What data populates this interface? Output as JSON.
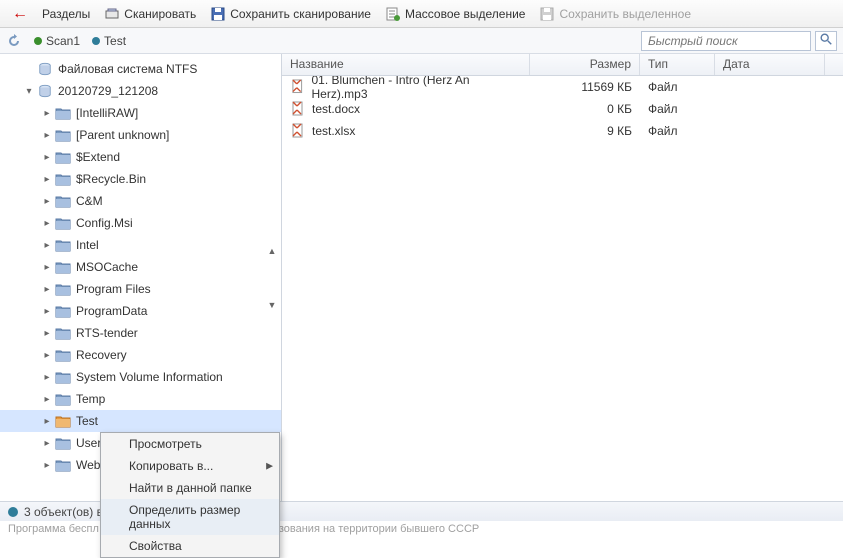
{
  "toolbar": {
    "back_label": "",
    "sections_label": "Разделы",
    "scan_label": "Сканировать",
    "save_scan_label": "Сохранить сканирование",
    "mass_select_label": "Массовое выделение",
    "save_selected_label": "Сохранить выделенное"
  },
  "tabs": {
    "scan1": "Scan1",
    "test": "Test"
  },
  "search": {
    "placeholder": "Быстрый поиск"
  },
  "tree": {
    "root_label": "Файловая система NTFS",
    "snapshot_label": "20120729_121208",
    "items": [
      "[IntelliRAW]",
      "[Parent unknown]",
      "$Extend",
      "$Recycle.Bin",
      "C&M",
      "Config.Msi",
      "Intel",
      "MSOCache",
      "Program Files",
      "ProgramData",
      "RTS-tender",
      "Recovery",
      "System Volume Information",
      "Temp",
      "Test",
      "Users",
      "Web"
    ],
    "selected_index": 14
  },
  "columns": {
    "name": "Название",
    "size": "Размер",
    "type": "Тип",
    "date": "Дата"
  },
  "files": [
    {
      "name": "01. Blumchen - Intro (Herz An Herz).mp3",
      "size": "11569 КБ",
      "type": "Файл",
      "date": ""
    },
    {
      "name": "test.docx",
      "size": "0 КБ",
      "type": "Файл",
      "date": ""
    },
    {
      "name": "test.xlsx",
      "size": "9 КБ",
      "type": "Файл",
      "date": ""
    }
  ],
  "context_menu": {
    "items": [
      "Просмотреть",
      "Копировать в...",
      "Найти в данной папке",
      "Определить размер данных",
      "Свойства"
    ],
    "highlight": 3
  },
  "status": {
    "text": "3 объект(ов) в"
  },
  "footer": {
    "left": "Программа беспл",
    "right": "зования на территории бывшего СССР"
  }
}
